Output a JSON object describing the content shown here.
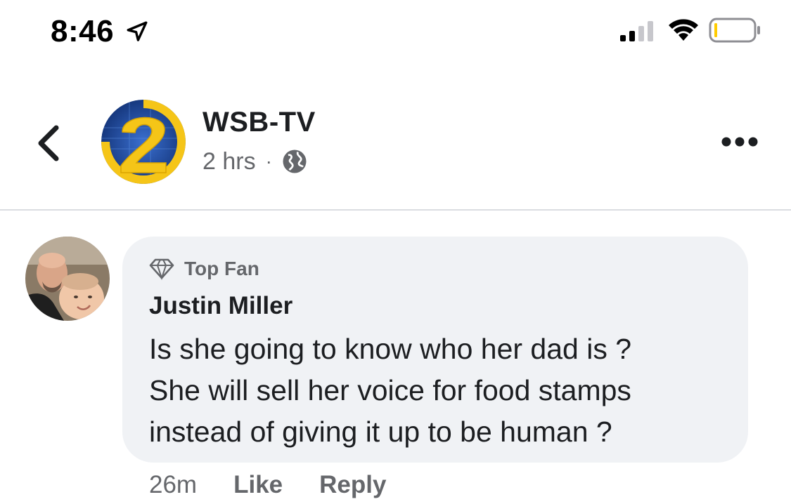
{
  "status_bar": {
    "time": "8:46",
    "icons": [
      "location-arrow-icon",
      "cellular-signal-icon",
      "wifi-icon",
      "battery-icon"
    ]
  },
  "post": {
    "page_name": "WSB-TV",
    "time_ago": "2 hrs",
    "separator": "·",
    "privacy_icon": "globe-icon",
    "logo": {
      "icon": "channel-2-logo",
      "colors": {
        "ring": "#f5c518",
        "background": "#1f4aa0"
      }
    }
  },
  "comment": {
    "badge": "Top Fan",
    "badge_icon": "diamond-icon",
    "author": "Justin Miller",
    "text_lines": [
      "Is she going to know who her dad is ?",
      "She will sell her voice for food stamps",
      "instead of giving it up to be human ?"
    ],
    "timestamp": "26m",
    "like_label": "Like",
    "reply_label": "Reply"
  },
  "colors": {
    "bubble": "#f0f2f5",
    "secondary_text": "#65676b",
    "primary_text": "#1c1e21",
    "divider": "#dadde1"
  }
}
